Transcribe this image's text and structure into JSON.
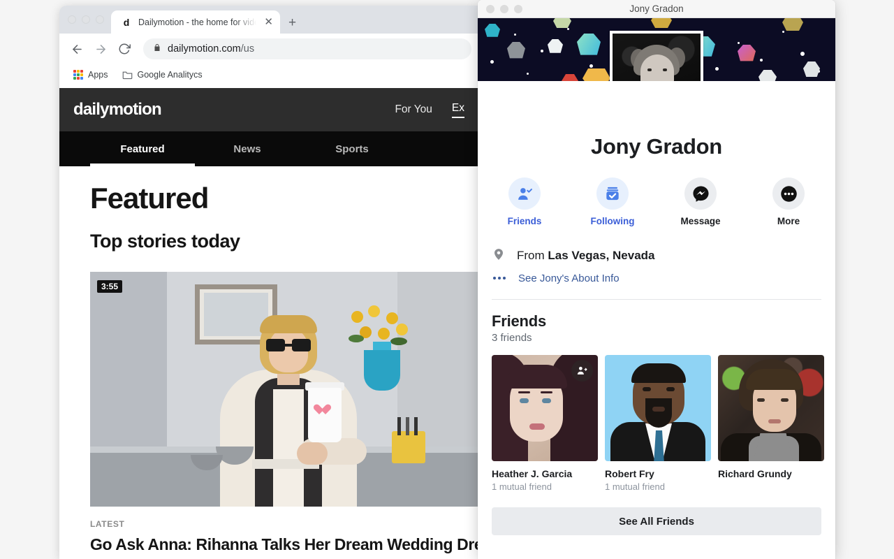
{
  "browser": {
    "window_controls": [
      "close",
      "minimize",
      "maximize"
    ],
    "tab": {
      "favicon_letter": "d",
      "title": "Dailymotion - the home for vide",
      "close_label": "✕"
    },
    "new_tab_label": "+",
    "toolbar": {
      "back_icon": "back-arrow-icon",
      "forward_icon": "forward-arrow-icon",
      "reload_icon": "reload-icon",
      "lock_icon": "lock-icon",
      "url_domain": "dailymotion.com",
      "url_path": "/us"
    },
    "bookmarks": [
      {
        "label": "Apps",
        "icon": "apps-grid-icon"
      },
      {
        "label": "Google Analitycs",
        "icon": "folder-icon"
      }
    ]
  },
  "dailymotion": {
    "logo": "dailymotion",
    "nav": [
      {
        "label": "For You",
        "active": false
      },
      {
        "label": "Ex",
        "active": true
      }
    ],
    "subnav": [
      {
        "label": "Featured",
        "active": true
      },
      {
        "label": "News",
        "active": false
      },
      {
        "label": "Sports",
        "active": false
      }
    ],
    "page_title": "Featured",
    "section_title": "Top stories today",
    "video": {
      "duration": "3:55"
    },
    "latest_label": "LATEST",
    "latest_title": "Go Ask Anna: Rihanna Talks Her Dream Wedding Dress,"
  },
  "facebook": {
    "window_title": "Jony Gradon",
    "profile": {
      "name": "Jony Gradon",
      "cover_photo_alt": "space-pattern-cover",
      "avatar_alt": "jony-gradon-portrait"
    },
    "actions": [
      {
        "label": "Friends",
        "icon": "friends-check-icon",
        "style": "blue"
      },
      {
        "label": "Following",
        "icon": "following-check-icon",
        "style": "blue"
      },
      {
        "label": "Message",
        "icon": "messenger-icon",
        "style": "dark"
      },
      {
        "label": "More",
        "icon": "more-dots-icon",
        "style": "dark"
      }
    ],
    "info": {
      "location_icon": "location-pin-icon",
      "from_prefix": "From",
      "location": "Las Vegas, Nevada",
      "about_icon": "ellipsis-icon",
      "about_link": "See Jony's About Info"
    },
    "friends": {
      "heading": "Friends",
      "count_label": "3 friends",
      "items": [
        {
          "name": "Heather J. Garcia",
          "mutual": "1 mutual friend",
          "badge": "add-friend-icon"
        },
        {
          "name": "Robert Fry",
          "mutual": "1 mutual friend",
          "badge": ""
        },
        {
          "name": "Richard Grundy",
          "mutual": "",
          "badge": ""
        }
      ],
      "see_all_label": "See All Friends"
    }
  },
  "colors": {
    "facebook_blue": "#1877f2",
    "link_blue": "#385898",
    "dark_text": "#1c1e21",
    "muted_text": "#8d949e",
    "cover_bg": "#0c0c24",
    "button_gray": "#e9ebee"
  }
}
